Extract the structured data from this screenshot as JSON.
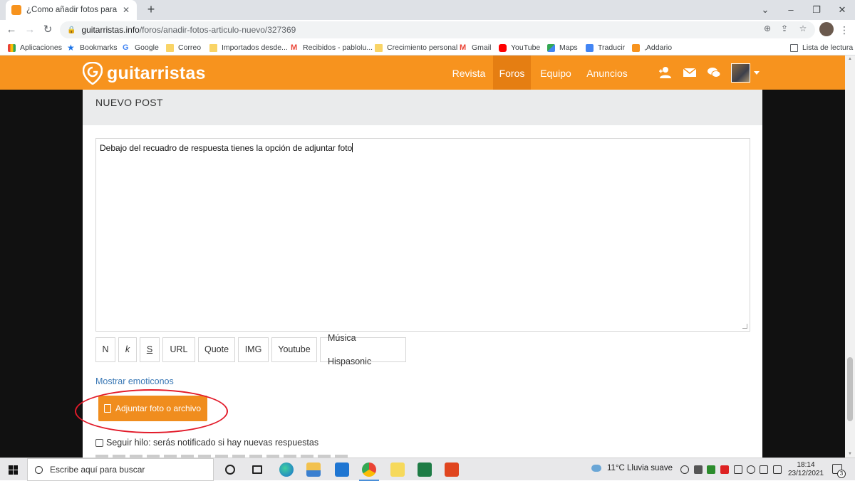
{
  "browser": {
    "tab_title": "¿Como añadir fotos para un artículo",
    "url_host": "guitarristas.info",
    "url_path": "/foros/anadir-fotos-articulo-nuevo/327369"
  },
  "bookmarks": {
    "items": [
      "Aplicaciones",
      "Bookmarks",
      "Google",
      "Correo",
      "Importados desde...",
      "Recibidos - pablolu...",
      "Crecimiento personal",
      "Gmail",
      "YouTube",
      "Maps",
      "Traducir",
      ",Addario"
    ],
    "reading_list": "Lista de lectura"
  },
  "site": {
    "logo": "guitarristas",
    "nav": [
      "Revista",
      "Foros",
      "Equipo",
      "Anuncios"
    ],
    "active_nav": "Foros",
    "brand_color": "#f7931e"
  },
  "post": {
    "title": "NUEVO POST",
    "body_text": "Debajo del recuadro de respuesta tienes la opción de adjuntar foto",
    "toolbar": [
      "N",
      "k",
      "S",
      "URL",
      "Quote",
      "IMG",
      "Youtube",
      "Música Hispasonic"
    ],
    "emoticons_link": "Mostrar emoticonos",
    "attach_button": "Adjuntar foto o archivo",
    "follow_label": "Seguir hilo: serás notificado si hay nuevas respuestas",
    "highlight_color": "#e21b2a"
  },
  "taskbar": {
    "search_placeholder": "Escribe aquí para buscar",
    "weather": "11°C  Lluvia suave",
    "time": "18:14",
    "date": "23/12/2021",
    "notifications": "3"
  }
}
